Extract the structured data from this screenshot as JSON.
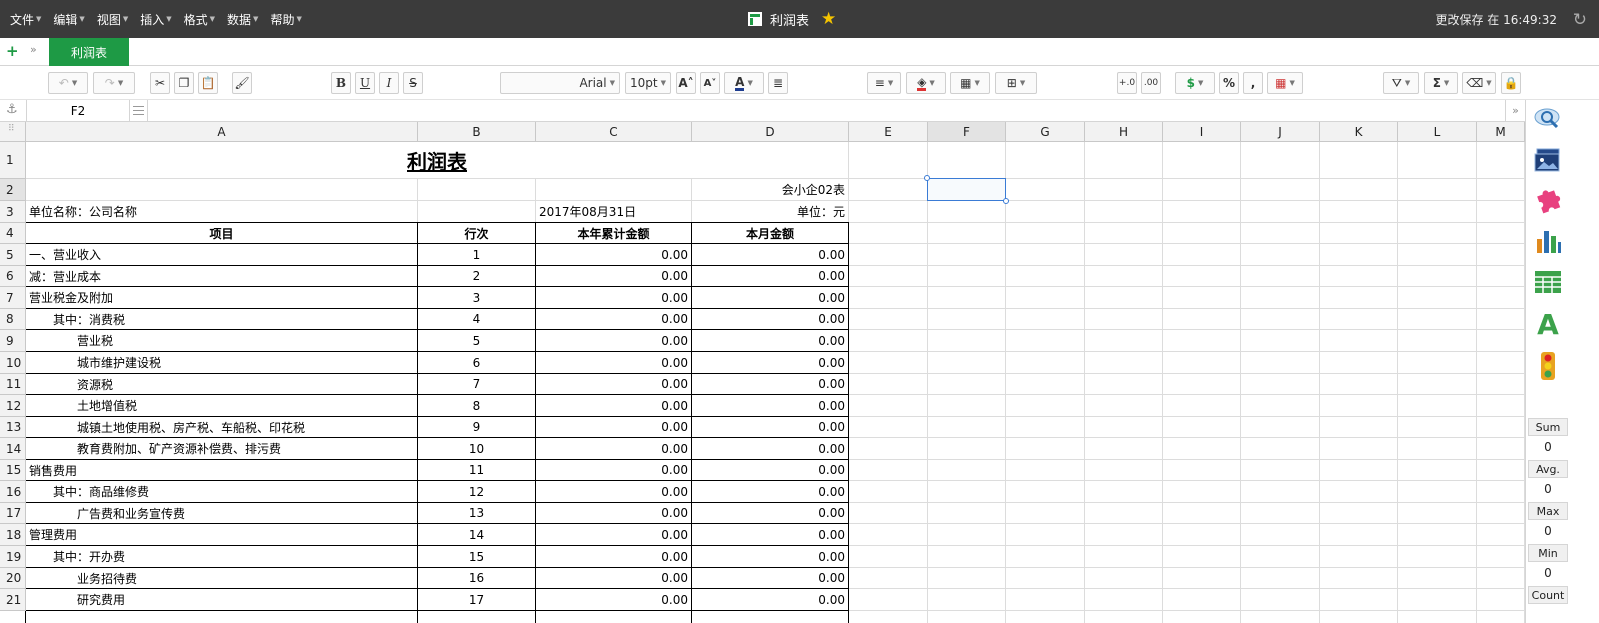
{
  "menubar": {
    "items": [
      "文件",
      "编辑",
      "视图",
      "插入",
      "格式",
      "数据",
      "帮助"
    ],
    "doc_title": "利润表",
    "save_status": "更改保存 在 16:49:32"
  },
  "tabbar": {
    "add_label": "+",
    "sheet_tab": "利润表"
  },
  "toolbar": {
    "font_name": "Arial",
    "font_size": "10pt",
    "bold": "B",
    "underline": "U",
    "italic": "I",
    "strike": "S",
    "currency": "$",
    "percent": "%",
    "comma": ",",
    "sigma": "Σ"
  },
  "formulabar": {
    "cell_ref": "F2"
  },
  "columns": [
    "A",
    "B",
    "C",
    "D",
    "E",
    "F",
    "G",
    "H",
    "I",
    "J",
    "K",
    "L",
    "M"
  ],
  "rows": [
    "1",
    "2",
    "3",
    "4",
    "5",
    "6",
    "7",
    "8",
    "9",
    "10",
    "11",
    "12",
    "13",
    "14",
    "15",
    "16",
    "17",
    "18",
    "19",
    "20",
    "21"
  ],
  "sheet": {
    "title": "利润表",
    "form_code": "会小企02表",
    "company": "单位名称：公司名称",
    "date": "2017年08月31日",
    "unit": "单位：元",
    "headers": [
      "项目",
      "行次",
      "本年累计金额",
      "本月金额"
    ],
    "items": [
      {
        "name": "一、营业收入",
        "indent": 0,
        "line": "1",
        "ytd": "0.00",
        "month": "0.00"
      },
      {
        "name": "减：营业成本",
        "indent": 0,
        "line": "2",
        "ytd": "0.00",
        "month": "0.00"
      },
      {
        "name": "营业税金及附加",
        "indent": 0,
        "line": "3",
        "ytd": "0.00",
        "month": "0.00"
      },
      {
        "name": "其中：消费税",
        "indent": 1,
        "line": "4",
        "ytd": "0.00",
        "month": "0.00"
      },
      {
        "name": "营业税",
        "indent": 2,
        "line": "5",
        "ytd": "0.00",
        "month": "0.00"
      },
      {
        "name": "城市维护建设税",
        "indent": 2,
        "line": "6",
        "ytd": "0.00",
        "month": "0.00"
      },
      {
        "name": "资源税",
        "indent": 2,
        "line": "7",
        "ytd": "0.00",
        "month": "0.00"
      },
      {
        "name": "土地增值税",
        "indent": 2,
        "line": "8",
        "ytd": "0.00",
        "month": "0.00"
      },
      {
        "name": "城镇土地使用税、房产税、车船税、印花税",
        "indent": 2,
        "line": "9",
        "ytd": "0.00",
        "month": "0.00"
      },
      {
        "name": "教育费附加、矿产资源补偿费、排污费",
        "indent": 2,
        "line": "10",
        "ytd": "0.00",
        "month": "0.00"
      },
      {
        "name": "销售费用",
        "indent": 0,
        "line": "11",
        "ytd": "0.00",
        "month": "0.00"
      },
      {
        "name": "其中：商品维修费",
        "indent": 1,
        "line": "12",
        "ytd": "0.00",
        "month": "0.00"
      },
      {
        "name": "广告费和业务宣传费",
        "indent": 2,
        "line": "13",
        "ytd": "0.00",
        "month": "0.00"
      },
      {
        "name": "管理费用",
        "indent": 0,
        "line": "14",
        "ytd": "0.00",
        "month": "0.00"
      },
      {
        "name": "其中：开办费",
        "indent": 1,
        "line": "15",
        "ytd": "0.00",
        "month": "0.00"
      },
      {
        "name": "业务招待费",
        "indent": 2,
        "line": "16",
        "ytd": "0.00",
        "month": "0.00"
      },
      {
        "name": "研究费用",
        "indent": 2,
        "line": "17",
        "ytd": "0.00",
        "month": "0.00"
      }
    ]
  },
  "stats": [
    {
      "label": "Sum",
      "value": "0"
    },
    {
      "label": "Avg.",
      "value": "0"
    },
    {
      "label": "Max",
      "value": "0"
    },
    {
      "label": "Min",
      "value": "0"
    },
    {
      "label": "Count",
      "value": ""
    }
  ],
  "colors": {
    "menubar_bg": "#3b3b3b",
    "accent_green": "#1e9a45",
    "star": "#f5c400",
    "selection": "#3a7bd5"
  }
}
